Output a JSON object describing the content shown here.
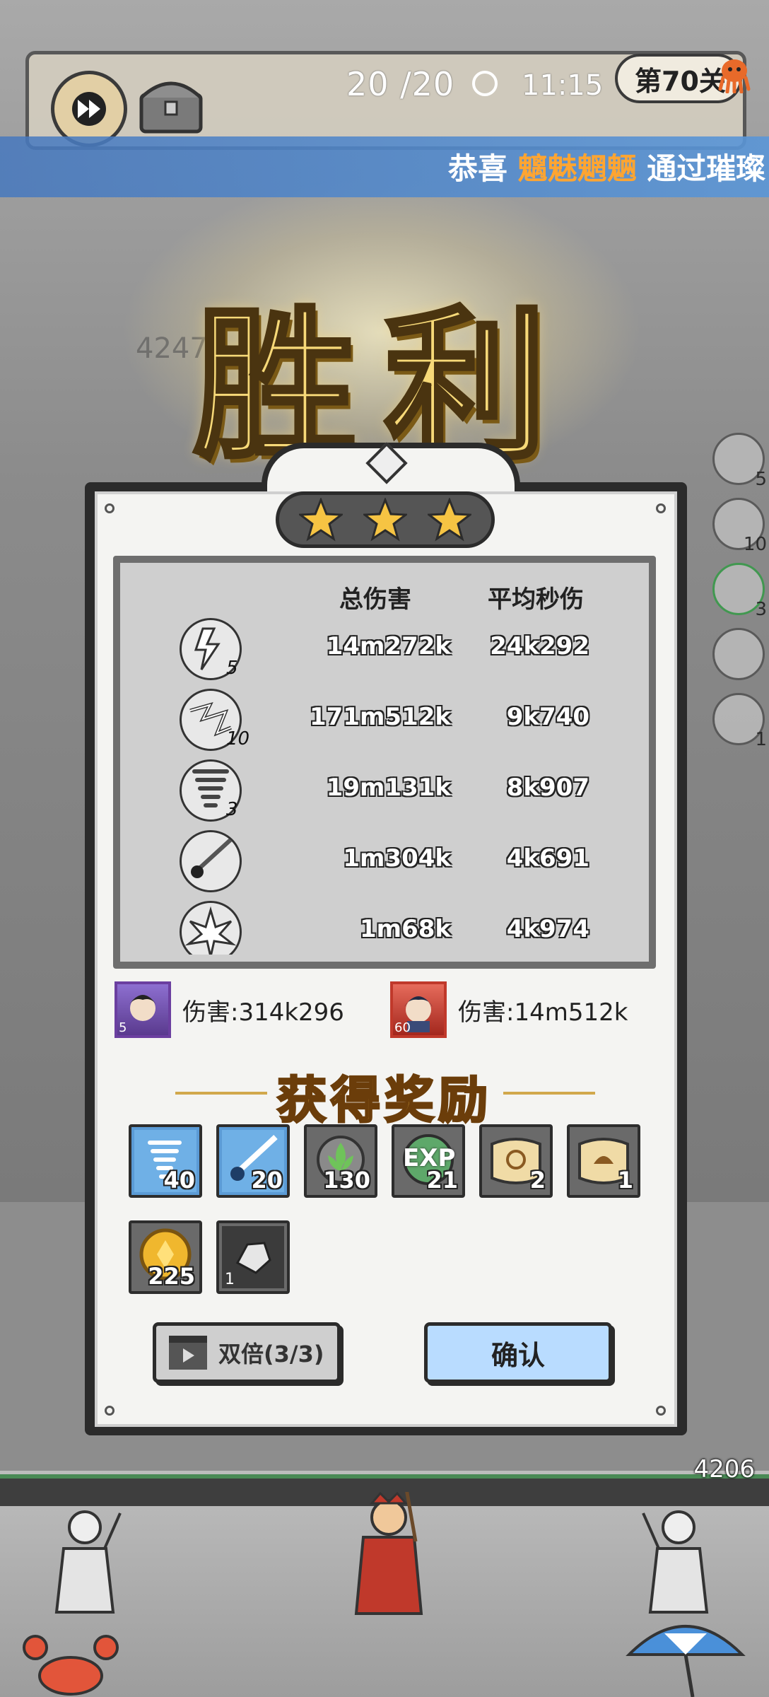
{
  "hud": {
    "counter": "20 /20",
    "time": "11:15",
    "level": "第70关"
  },
  "banner": {
    "prefix": "恭喜",
    "player_name": "魑魅魍魉",
    "suffix": "通过璀璨"
  },
  "victory": {
    "title": "胜利"
  },
  "stars": {
    "earned": 3,
    "total": 3
  },
  "stats": {
    "header_total": "总伤害",
    "header_dps": "平均秒伤",
    "rows": [
      {
        "icon": "lightning-rock-icon",
        "level": "5",
        "total": "14m272k",
        "dps": "24k292"
      },
      {
        "icon": "chain-lightning-icon",
        "level": "10",
        "total": "171m512k",
        "dps": "9k740"
      },
      {
        "icon": "tornado-icon",
        "level": "3",
        "total": "19m131k",
        "dps": "8k907"
      },
      {
        "icon": "meteor-icon",
        "level": "",
        "total": "1m304k",
        "dps": "4k691"
      },
      {
        "icon": "crystal-burst-icon",
        "level": "",
        "total": "1m68k",
        "dps": "4k974"
      }
    ]
  },
  "heroes": [
    {
      "level": "5",
      "damage": "伤害:314k296",
      "frame_color": "#6b3fa0"
    },
    {
      "level": "60",
      "damage": "伤害:14m512k",
      "frame_color": "#c0392b"
    }
  ],
  "rewards": {
    "title": "获得奖励",
    "items": [
      {
        "icon": "tornado-card-icon",
        "count": "40",
        "bg": "#5b9bd6"
      },
      {
        "icon": "meteor-card-icon",
        "count": "20",
        "bg": "#5b9bd6"
      },
      {
        "icon": "leaf-emblem-icon",
        "count": "130",
        "bg": "#6a6a6a"
      },
      {
        "icon": "exp-orb-icon",
        "count": "21",
        "bg": "#6a6a6a"
      },
      {
        "icon": "scroll-map-icon",
        "count": "2",
        "bg": "#6a6a6a"
      },
      {
        "icon": "scroll-hat-icon",
        "count": "1",
        "bg": "#6a6a6a"
      },
      {
        "icon": "gold-coin-icon",
        "count": "225",
        "bg": "#6a6a6a"
      },
      {
        "icon": "ore-stone-icon",
        "count": "1",
        "bg": "#6a6a6a"
      }
    ],
    "exp_label": "EXP"
  },
  "buttons": {
    "double": "双倍(3/3)",
    "confirm": "确认"
  },
  "ground_value": "4206",
  "side_skill_levels": [
    "5",
    "10",
    "3",
    "",
    "1"
  ],
  "ghost_damage": "4247"
}
